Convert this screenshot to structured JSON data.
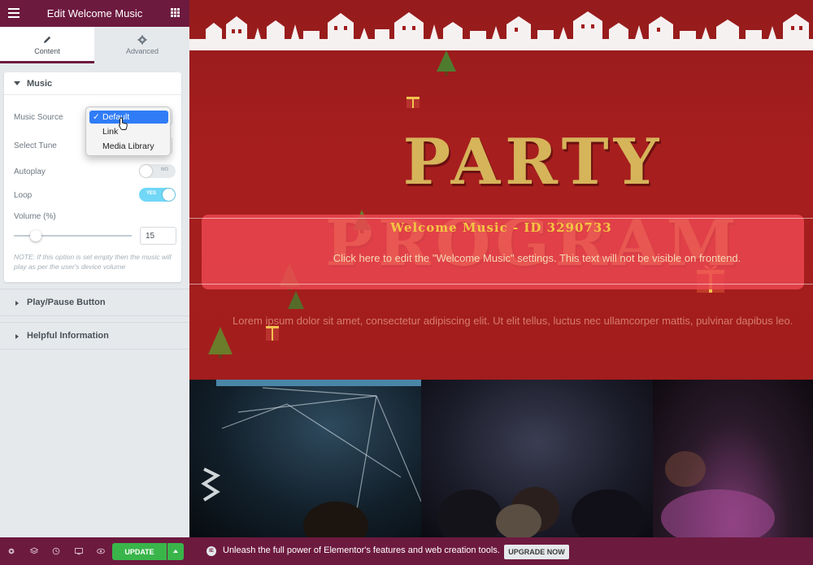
{
  "panel": {
    "title": "Edit Welcome Music",
    "tabs": [
      {
        "label": "Content",
        "active": true
      },
      {
        "label": "Advanced",
        "active": false
      }
    ],
    "music_section": {
      "title": "Music",
      "music_source_label": "Music Source",
      "music_source_options": [
        "Default",
        "Link",
        "Media Library"
      ],
      "music_source_selected": "Default",
      "select_tune_label": "Select Tune",
      "autoplay_label": "Autoplay",
      "autoplay_state": "NO",
      "loop_label": "Loop",
      "loop_state": "YES",
      "volume_label": "Volume (%)",
      "volume_value": "15",
      "volume_level_fraction": 0.15,
      "note": "NOTE: If this option is set empty then the music will play as per the user's device volume"
    },
    "sections": [
      "Play/Pause Button",
      "Helpful Information"
    ],
    "toolbar": {
      "update_label": "UPDATE",
      "icons": [
        "gear-icon",
        "layers-icon",
        "history-icon",
        "responsive-icon",
        "eye-icon"
      ]
    }
  },
  "preview": {
    "title": "PARTY PROGRAM",
    "widget_label": "Welcome Music - ID 3290733",
    "edit_hint": "Click here to edit the \"Welcome Music\" settings. This text will not be visible on frontend.",
    "lorem": "Lorem ipsum dolor sit amet, consectetur adipiscing elit. Ut elit tellus, luctus nec ullamcorper mattis, pulvinar dapibus leo."
  },
  "promo": {
    "text": "Unleash the full power of Elementor's features and web creation tools.",
    "button_label": "UPGRADE NOW",
    "icon_text": "IE"
  },
  "colors": {
    "panel_header": "#6d1a3f",
    "update_green": "#39b54a",
    "hero_red": "#a21d1d",
    "title_gold": "#d6b45a"
  }
}
